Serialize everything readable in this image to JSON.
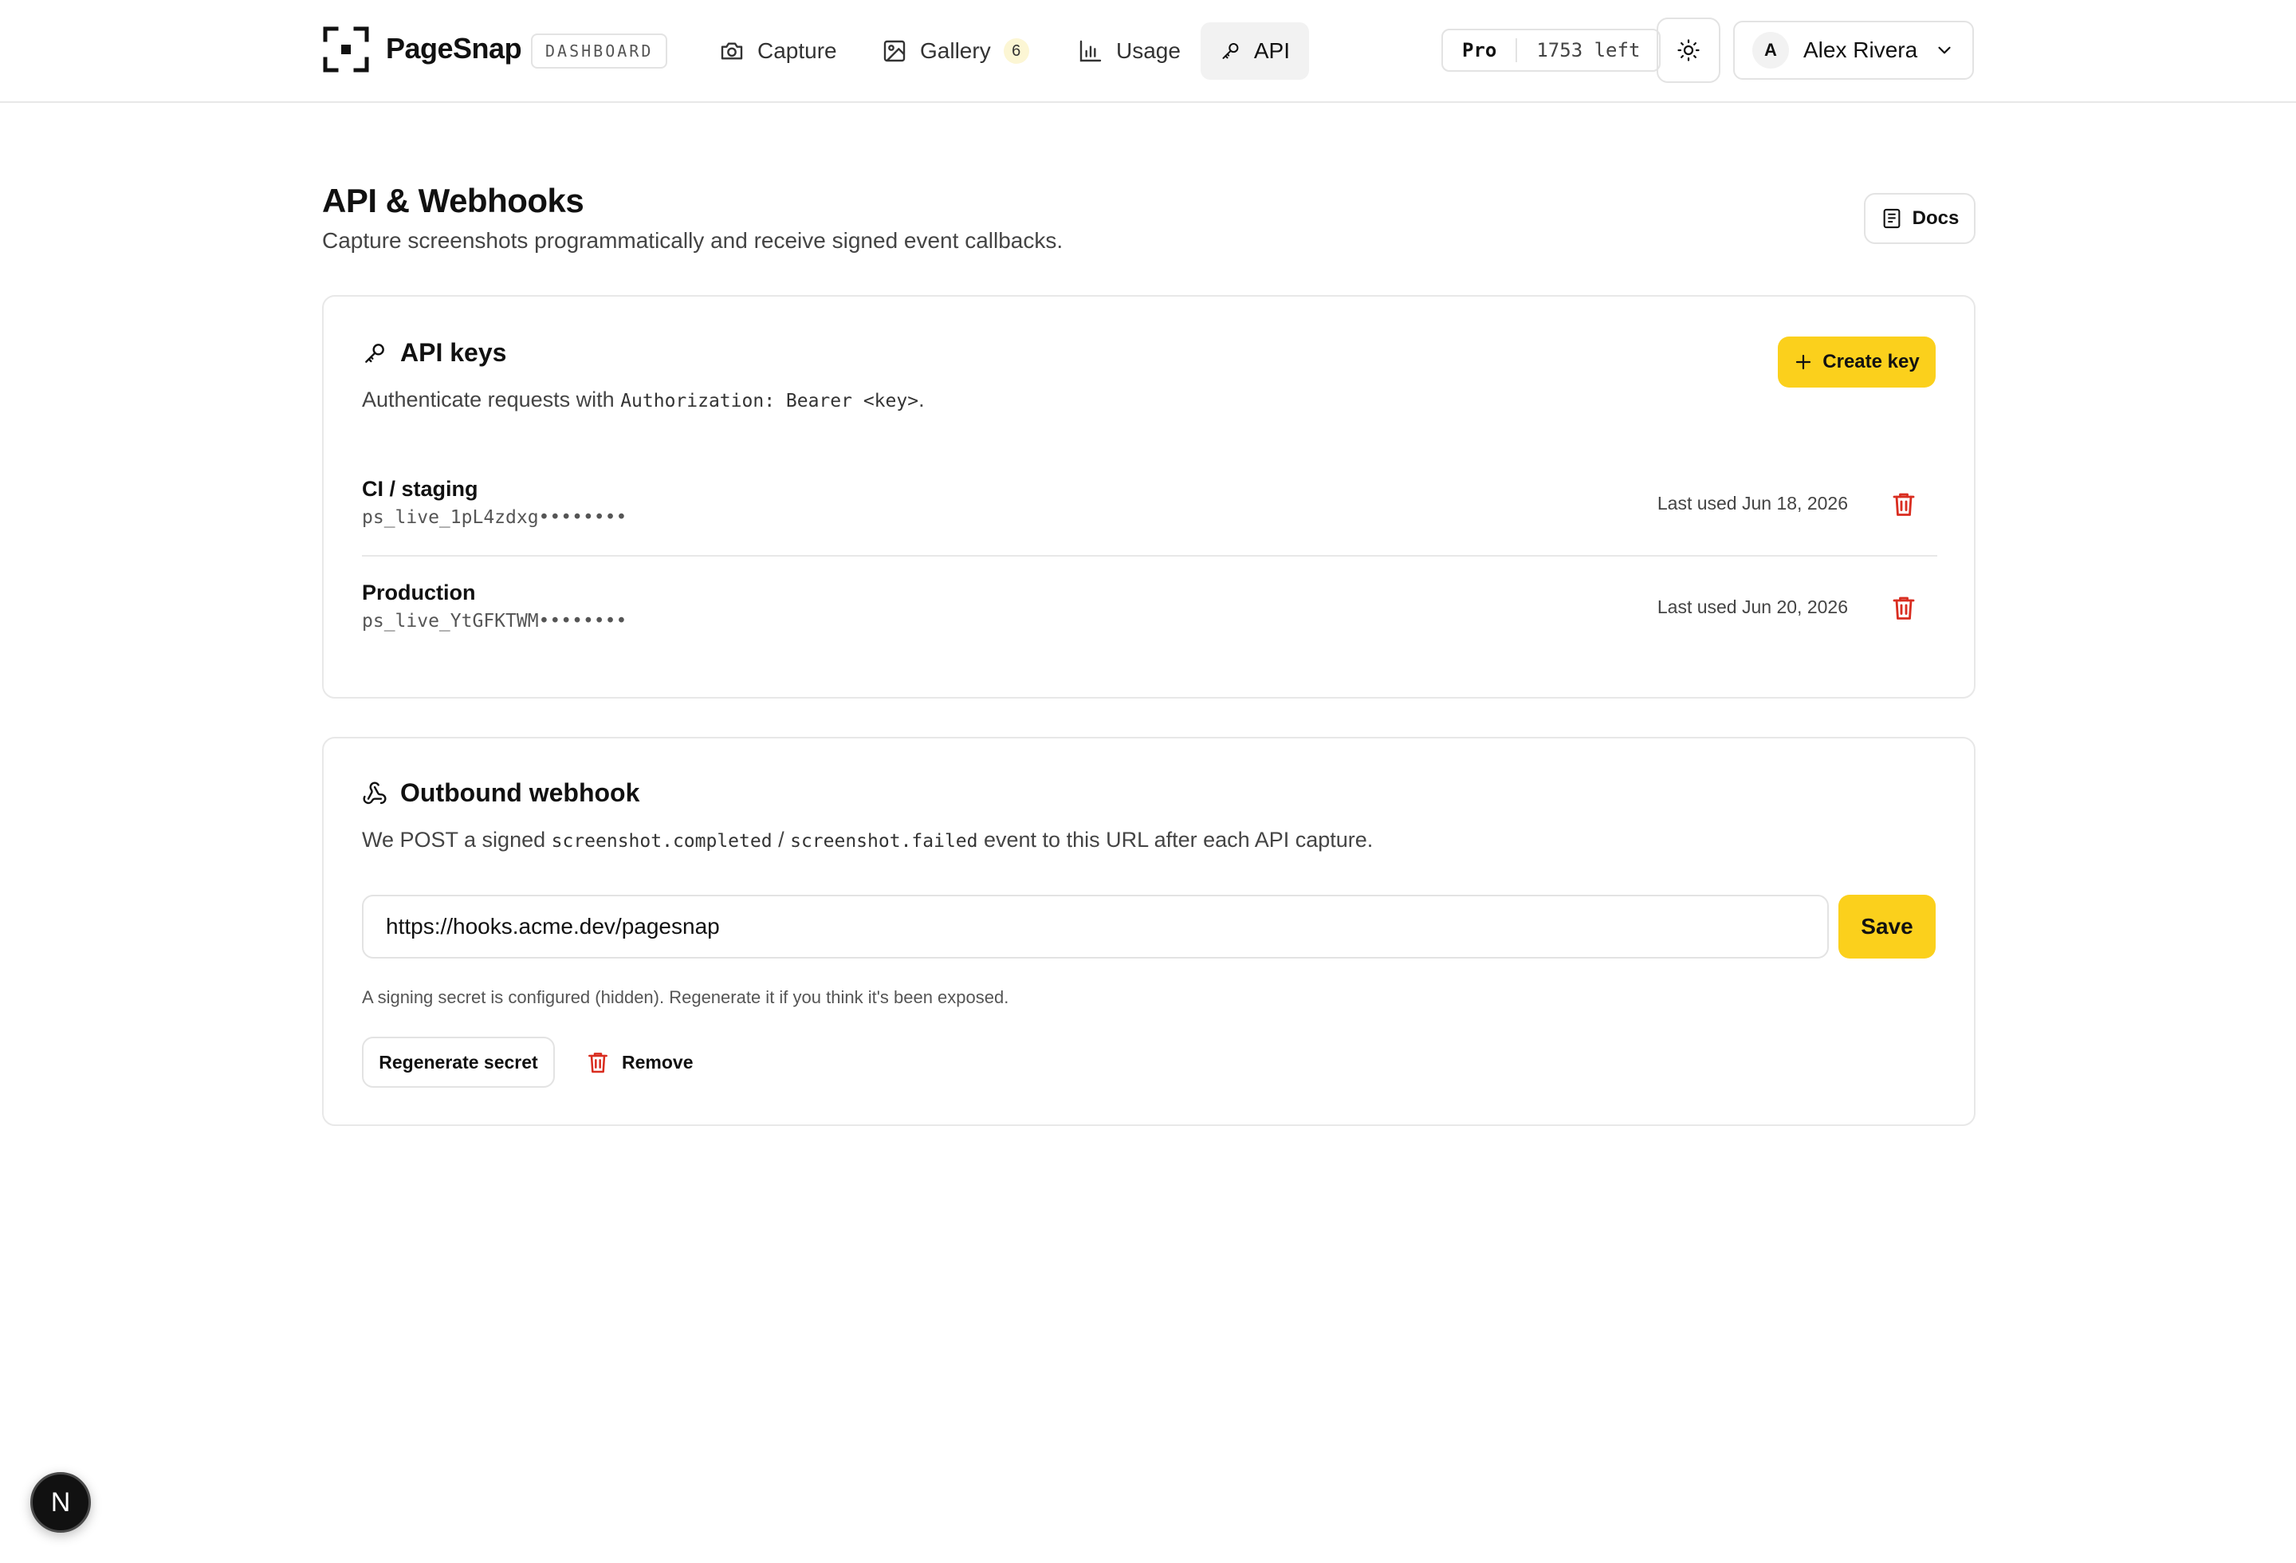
{
  "header": {
    "brand": "PageSnap",
    "badge": "DASHBOARD",
    "nav": [
      {
        "label": "Capture",
        "icon": "camera-icon"
      },
      {
        "label": "Gallery",
        "icon": "image-icon",
        "count": "6"
      },
      {
        "label": "Usage",
        "icon": "bar-chart-icon"
      },
      {
        "label": "API",
        "icon": "key-icon",
        "active": true
      }
    ],
    "plan": "Pro",
    "quota": "1753 left",
    "user": {
      "initial": "A",
      "name": "Alex Rivera"
    }
  },
  "page": {
    "title": "API & Webhooks",
    "subtitle": "Capture screenshots programmatically and receive signed event callbacks.",
    "docs_label": "Docs"
  },
  "api_keys": {
    "title": "API keys",
    "desc_before": "Authenticate requests with ",
    "desc_code": "Authorization: Bearer <key>",
    "desc_after": ".",
    "create_label": "Create key",
    "keys": [
      {
        "name": "CI / staging",
        "key": "ps_live_1pL4zdxg••••••••",
        "last_used": "Last used Jun 18, 2026"
      },
      {
        "name": "Production",
        "key": "ps_live_YtGFKTWM••••••••",
        "last_used": "Last used Jun 20, 2026"
      }
    ]
  },
  "webhook": {
    "title": "Outbound webhook",
    "desc_1": "We POST a signed ",
    "code_1": "screenshot.completed",
    "desc_2": " / ",
    "code_2": "screenshot.failed",
    "desc_3": " event to this URL after each API capture.",
    "url_value": "https://hooks.acme.dev/pagesnap",
    "save_label": "Save",
    "hint": "A signing secret is configured (hidden). Regenerate it if you think it's been exposed.",
    "regenerate_label": "Regenerate secret",
    "remove_label": "Remove"
  },
  "dev_badge": "N",
  "colors": {
    "accent": "#fbd01c",
    "danger": "#d92d20",
    "border": "#e8e8e8"
  }
}
